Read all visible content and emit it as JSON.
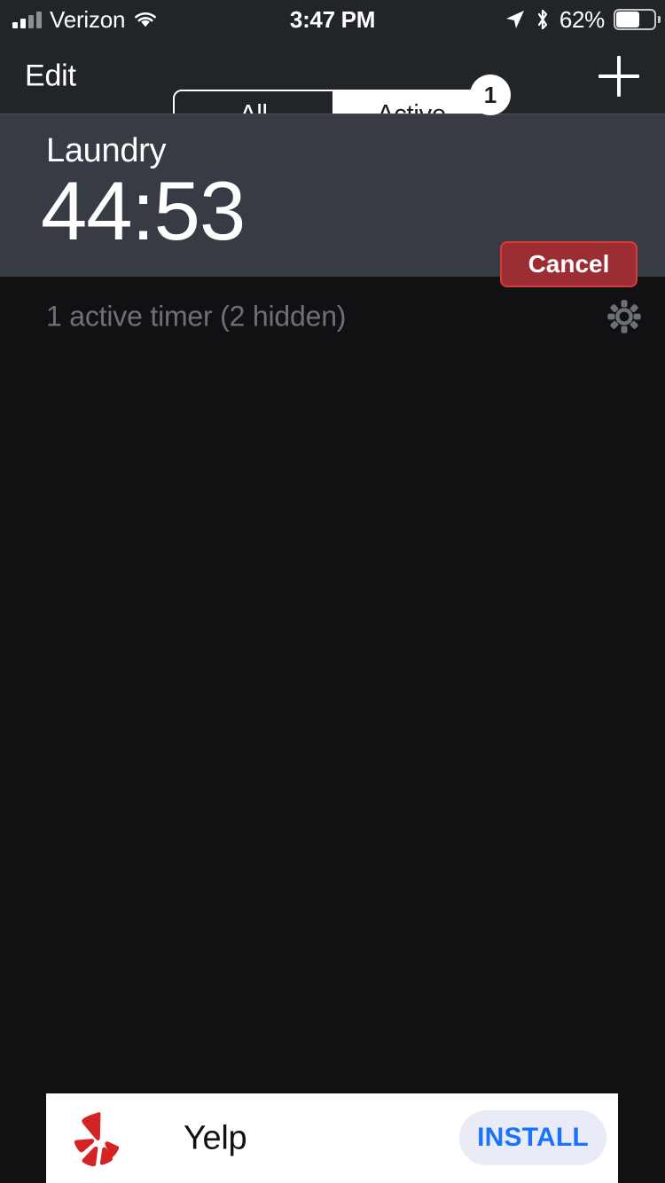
{
  "status_bar": {
    "carrier": "Verizon",
    "time": "3:47 PM",
    "battery_percent": "62%",
    "signal_icon": "signal-bars-icon",
    "wifi_icon": "wifi-icon",
    "location_icon": "location-arrow-icon",
    "bluetooth_icon": "bluetooth-icon",
    "battery_icon": "battery-icon"
  },
  "nav_bar": {
    "edit_label": "Edit",
    "segments": [
      {
        "label": "All",
        "selected": false
      },
      {
        "label": "Active",
        "selected": true
      }
    ],
    "badge_count": "1",
    "add_icon": "plus-icon"
  },
  "timer": {
    "name": "Laundry",
    "remaining": "44:53",
    "cancel_label": "Cancel"
  },
  "list_status": {
    "text": "1 active timer (2 hidden)",
    "settings_icon": "gear-icon"
  },
  "ad": {
    "app_name": "Yelp",
    "install_label": "INSTALL",
    "logo_icon": "yelp-burst-icon"
  },
  "colors": {
    "background": "#111114",
    "chrome": "#212429",
    "card": "#373b43",
    "cancel_fill": "#9b2d33",
    "cancel_border": "#d93b3b",
    "muted_text": "#6d7076",
    "install_text": "#1a73ff",
    "install_fill": "#e9ebf6",
    "yelp_red": "#d32323"
  }
}
